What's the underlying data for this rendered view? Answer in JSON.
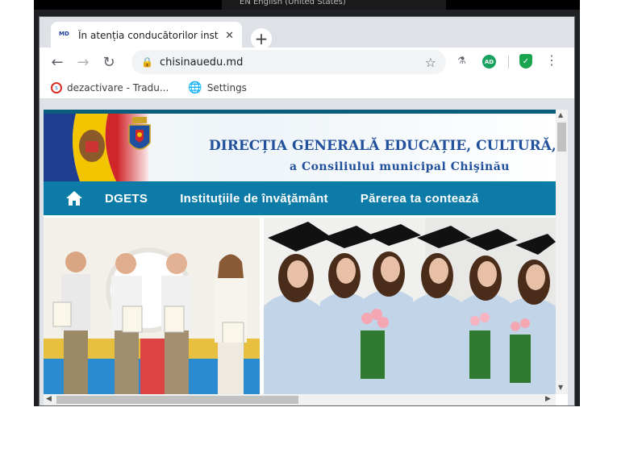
{
  "os": {
    "lang_text": "EN English (United States)"
  },
  "tab": {
    "favicon_text": "MD",
    "title": "În atenția conducătorilor instituți",
    "close_glyph": "✕",
    "new_tab_glyph": "+"
  },
  "toolbar": {
    "back_glyph": "←",
    "forward_glyph": "→",
    "reload_glyph": "↻",
    "url": "chisinauedu.md",
    "ext_badge": "AD",
    "menu_glyph": "⋮"
  },
  "bookmarks": [
    {
      "label": "dezactivare - Tradu..."
    },
    {
      "label": "Settings"
    }
  ],
  "site": {
    "banner_title": "DIRECȚIA GENERALĂ EDUCAȚIE, CULTURĂ, TINE",
    "banner_subtitle": "a Consiliului  municipal Chişinău",
    "nav": [
      {
        "label": "DGETS"
      },
      {
        "label": "Instituţiile de învăţământ"
      },
      {
        "label": "Părerea ta contează"
      }
    ]
  },
  "colors": {
    "nav_bg": "#0d7ba8",
    "banner_text": "#21509c",
    "top_bar": "#0b5e7b"
  }
}
